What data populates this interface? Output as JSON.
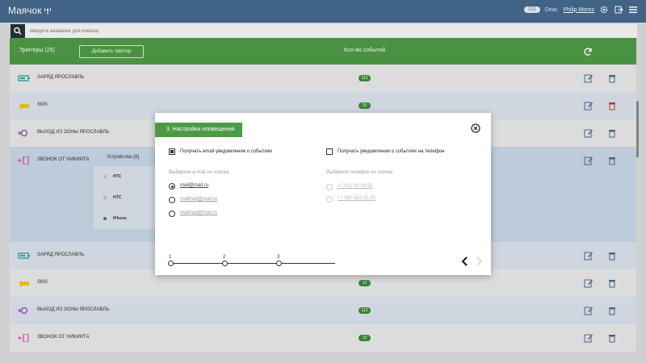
{
  "app": {
    "title": "Маячок",
    "notification_count": "112",
    "greeting": "Dear,",
    "user_name": "Philip Morris"
  },
  "search": {
    "placeholder": "Введите название для поиска)"
  },
  "header": {
    "triggers_title": "Триггеры (25)",
    "add_button": "Добавить триггер",
    "events_count_label": "Кол-во событий"
  },
  "rows": [
    {
      "name": "Заряд Ярославль",
      "icon": "battery-icon",
      "count": "112"
    },
    {
      "name": "SMS",
      "icon": "sms-icon",
      "count": "32"
    },
    {
      "name": "Выход из зоны Ярославль",
      "icon": "zone-exit-icon",
      "count": ""
    },
    {
      "name": "Звонок от Никиита",
      "icon": "phone-call-icon",
      "count": ""
    },
    {
      "name": "Заряд Ярославль",
      "icon": "battery-icon",
      "count": ""
    },
    {
      "name": "SMS",
      "icon": "sms-icon",
      "count": "12"
    },
    {
      "name": "Выход из зоны Ярославль",
      "icon": "zone-exit-icon",
      "count": "112"
    },
    {
      "name": "Звонок от Никиита",
      "icon": "phone-call-icon",
      "count": "12"
    }
  ],
  "devices": {
    "title": "Устройства (8)",
    "items": [
      "HTC",
      "HTC",
      "IPhone"
    ]
  },
  "modal": {
    "title": "3. Настройка оповещения",
    "email_checkbox_label": "Получать email уведомления о событиях",
    "phone_checkbox_label": "Получать уведомления о событиях на телефон",
    "email_select_label": "Выберите e-mail из списка:",
    "phone_select_label": "Выберите телефон из списка:",
    "emails": [
      "mail@mail.ru",
      "mailmail@mail.ru",
      "mailmail@mail.ru"
    ],
    "phones": [
      "+7 910 95 95 95",
      "+7 980 652 25 25"
    ],
    "steps": [
      "1",
      "2",
      "3"
    ]
  },
  "colors": {
    "topbar": "#45698e",
    "green": "#4d9a45",
    "badge": "#3c8c3c",
    "delete_red": "#c0392b"
  }
}
